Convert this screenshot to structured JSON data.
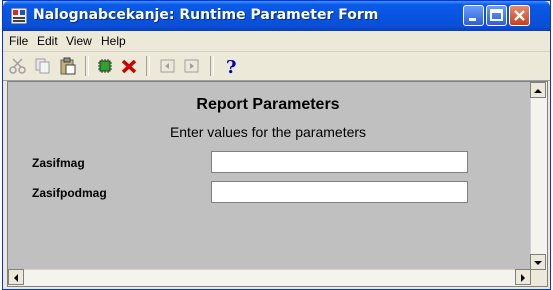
{
  "window": {
    "title": "Nalognabcekanje: Runtime Parameter Form"
  },
  "menu": {
    "file": "File",
    "edit": "Edit",
    "view": "View",
    "help": "Help"
  },
  "toolbar": {
    "icons": [
      "cut-icon",
      "copy-icon",
      "paste-icon",
      "run-icon",
      "cancel-icon",
      "prev-page-icon",
      "next-page-icon",
      "help-icon"
    ],
    "help_glyph": "?"
  },
  "form": {
    "title": "Report Parameters",
    "subtitle": "Enter values for the parameters",
    "params": [
      {
        "label": "Zasifmag",
        "value": ""
      },
      {
        "label": "Zasifpodmag",
        "value": ""
      }
    ]
  },
  "colors": {
    "titlebar": "#0754e0",
    "client_bg": "#c0c0c0",
    "chrome": "#ece9d8",
    "cancel_red": "#d00000",
    "help_blue": "#0000c0"
  }
}
